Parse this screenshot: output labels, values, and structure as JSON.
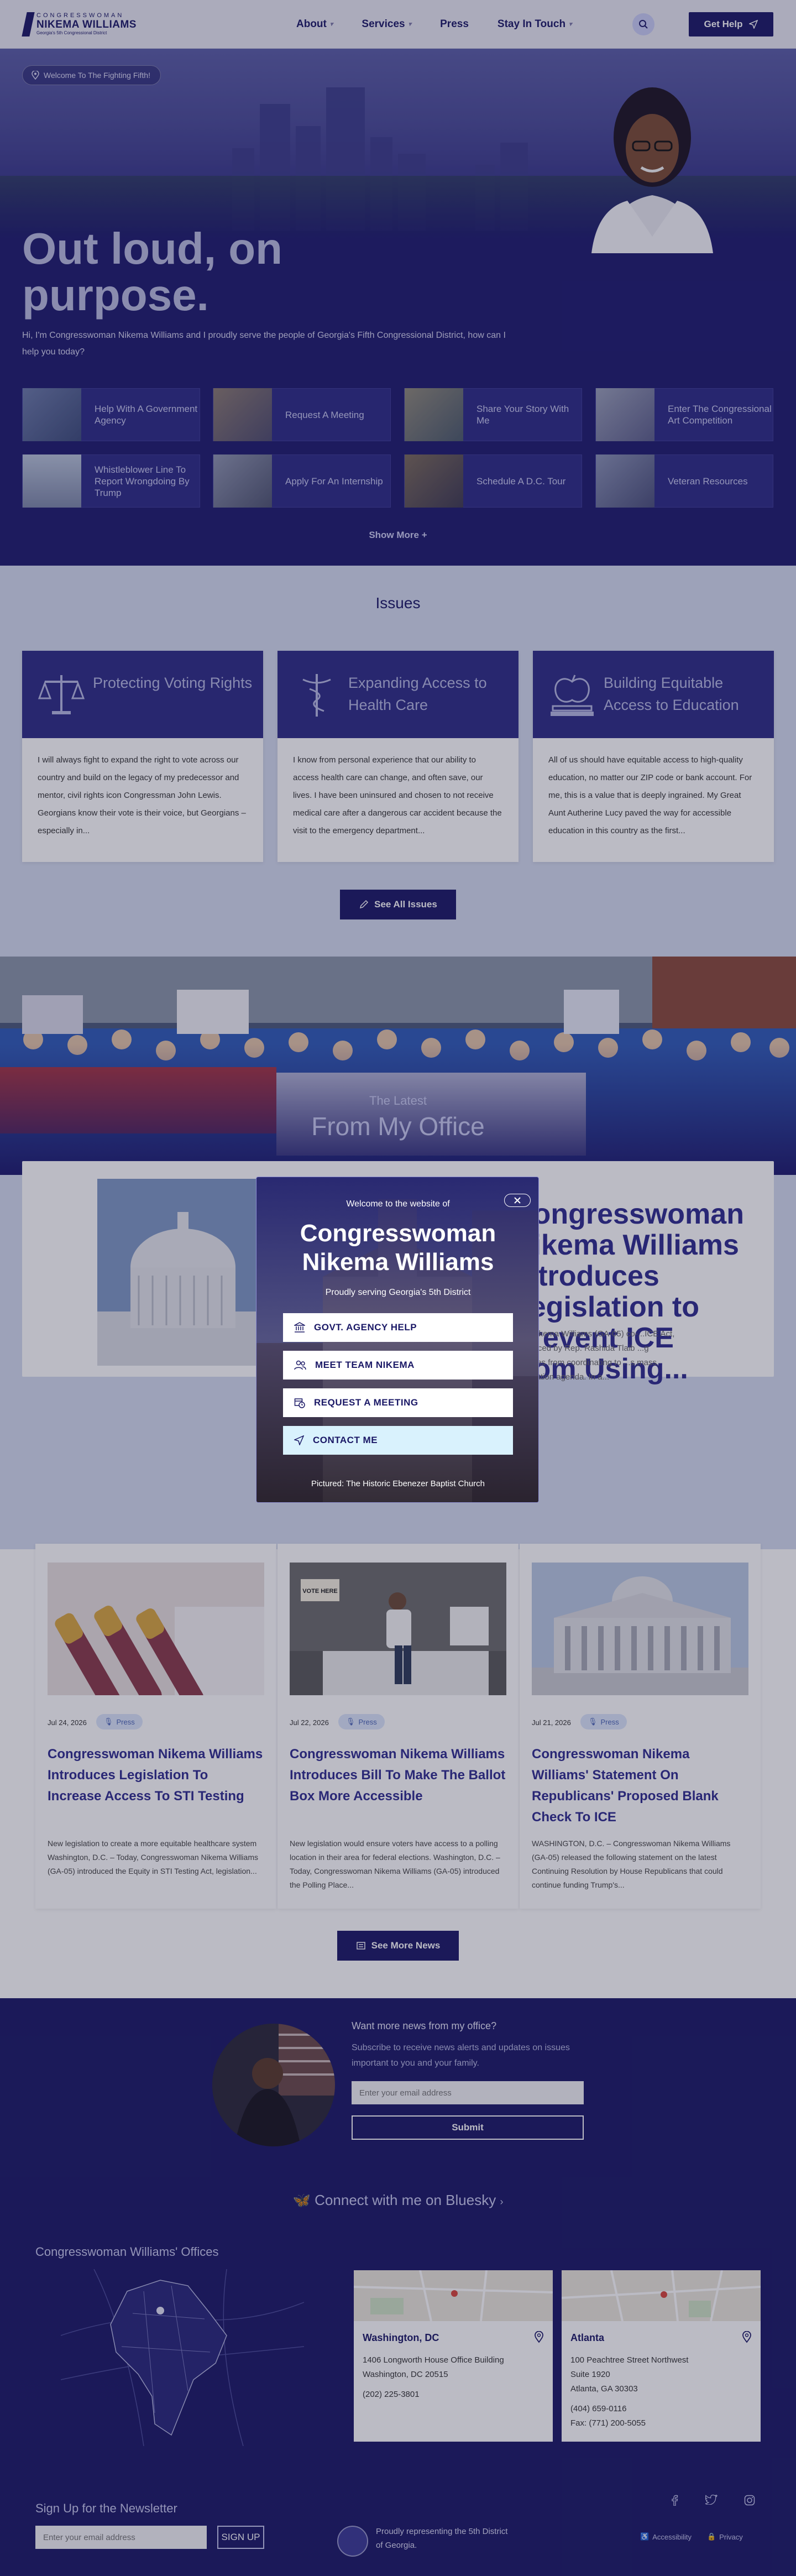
{
  "header": {
    "logo_top": "CONGRESSWOMAN",
    "logo_name": "NIKEMA WILLIAMS",
    "logo_tag": "Georgia's 5th Congressional District",
    "nav": [
      "About",
      "Services",
      "Press",
      "Stay In Touch"
    ],
    "get_help": "Get Help"
  },
  "hero": {
    "welcome": "Welcome To The Fighting Fifth!",
    "title": "Out loud, on purpose.",
    "subtitle": "Hi, I'm Congresswoman Nikema Williams and I proudly serve the people of Georgia's Fifth Congressional District, how can I help you today?",
    "tiles": [
      "Help With A Government Agency",
      "Request A Meeting",
      "Share Your Story With Me",
      "Enter The Congressional Art Competition",
      "Whistleblower Line To Report Wrongdoing By Trump",
      "Apply For An Internship",
      "Schedule A D.C. Tour",
      "Veteran Resources"
    ],
    "show_more": "Show More +"
  },
  "issues": {
    "heading": "Issues",
    "cards": [
      {
        "title": "Protecting Voting Rights",
        "text": "I will always fight to expand the right to vote across our country and build on the legacy of my predecessor and mentor, civil rights icon Congressman John Lewis. Georgians know their vote is their voice, but Georgians – especially in..."
      },
      {
        "title": "Expanding Access to Health Care",
        "text": "I know from personal experience that our ability to access health care can change, and often save, our lives. I have been uninsured and chosen to not receive medical care after a dangerous car accident because the visit to the emergency department..."
      },
      {
        "title": "Building Equitable Access to Education",
        "text": "All of us should have equitable access to high-quality education, no matter our ZIP code or bank account. For me, this is a value that is deeply ingrained. My Great Aunt Autherine Lucy paved the way for accessible education in this country as the first..."
      }
    ],
    "button": "See All Issues"
  },
  "latest": {
    "kicker": "The Latest",
    "title": "From My Office",
    "featured_title": "Congresswoman Nikema Williams Introduces Legislation to Prevent ICE from Using...",
    "featured_text": "...an Nikema Williams (GA-05) co-...ICE Act, introduced by Rep. Rashida Tlaib ...g agencies from coordinating to ...s mass deportation agenda. In a..."
  },
  "news": {
    "items": [
      {
        "date": "Jul 24, 2026",
        "tag": "Press",
        "title": "Congresswoman Nikema Williams Introduces Legislation To Increase Access To STI Testing",
        "text": "New legislation to create a more equitable healthcare system Washington, D.C. – Today, Congresswoman Nikema Williams (GA-05) introduced the Equity in STI Testing Act, legislation..."
      },
      {
        "date": "Jul 22, 2026",
        "tag": "Press",
        "title": "Congresswoman Nikema Williams Introduces Bill To Make The Ballot Box More Accessible",
        "text": "New legislation would ensure voters have access to a polling location in their area for federal elections. Washington, D.C. – Today, Congresswoman Nikema Williams (GA-05) introduced the Polling Place..."
      },
      {
        "date": "Jul 21, 2026",
        "tag": "Press",
        "title": "Congresswoman Nikema Williams' Statement On Republicans' Proposed Blank Check To ICE",
        "text": "WASHINGTON, D.C. – Congresswoman Nikema Williams (GA-05) released the following statement on the latest Continuing Resolution by House Republicans that could continue funding Trump's..."
      }
    ],
    "button": "See More News",
    "vote_sign": "VOTE HERE"
  },
  "newsletter": {
    "question": "Want more news from my office?",
    "subtitle": "Subscribe to receive news alerts and updates on issues important to you and your family.",
    "email_placeholder": "Enter your email address",
    "submit": "Submit",
    "bluesky": "Connect with me on Bluesky"
  },
  "offices": {
    "heading": "Congresswoman Williams' Offices",
    "list": [
      {
        "name": "Washington, DC",
        "lines": [
          "1406 Longworth House Office Building",
          "Washington, DC 20515",
          "",
          "(202) 225-3801"
        ]
      },
      {
        "name": "Atlanta",
        "lines": [
          "100 Peachtree Street Northwest",
          "Suite 1920",
          "Atlanta, GA 30303",
          "",
          "(404) 659-0116",
          "Fax: (771) 200-5055"
        ]
      }
    ]
  },
  "footer": {
    "title": "Sign Up for the Newsletter",
    "email_placeholder": "Enter your email address",
    "signup": "SIGN UP",
    "rep_line": "Proudly representing the 5th District of Georgia.",
    "accessibility": "Accessibility",
    "privacy": "Privacy"
  },
  "modal": {
    "welcome": "Welcome to the website of",
    "title": "Congresswoman Nikema Williams",
    "subtitle": "Proudly serving Georgia's 5th District",
    "buttons": [
      "GOVT. AGENCY HELP",
      "MEET TEAM NIKEMA",
      "REQUEST A MEETING",
      "CONTACT ME"
    ],
    "caption": "Pictured: The Historic Ebenezer Baptist Church"
  }
}
